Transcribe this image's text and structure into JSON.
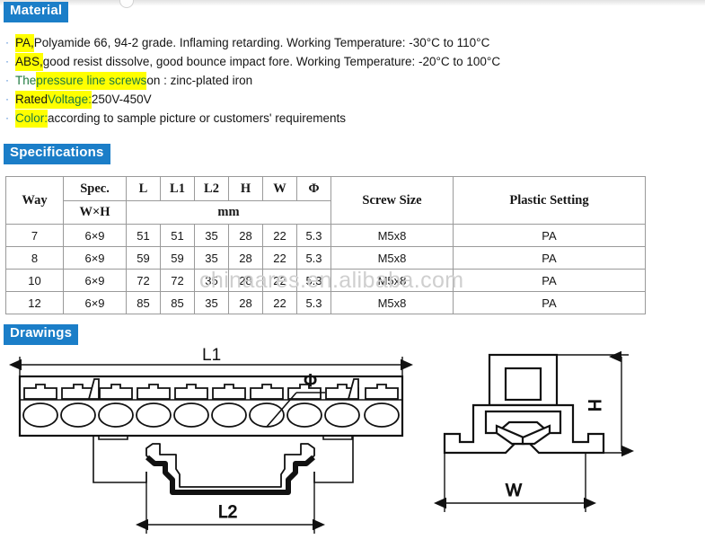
{
  "sections": {
    "material_title": "Material",
    "specifications_title": "Specifications",
    "drawings_title": "Drawings"
  },
  "material": {
    "bullet_glyph": "·",
    "items": [
      {
        "lead": "PA,",
        "lead_highlight": true,
        "lead_color": "black",
        "rest": " Polyamide 66, 94-2 grade. Inflaming retarding. Working Temperature:  -30°C to 110°C"
      },
      {
        "lead": "ABS,",
        "lead_highlight": true,
        "lead_color": "black",
        "rest": " good resist dissolve, good bounce impact fore. Working Temperature: -20°C to 100°C"
      },
      {
        "pre": "The ",
        "pre_color": "green",
        "mid": "pressure line screws",
        "mid_highlight": true,
        "mid_color": "green",
        "rest": " on :  zinc-plated iron"
      },
      {
        "lead": "Rated ",
        "lead_highlight": true,
        "lead_color": "black",
        "mid": "Voltage:",
        "mid_highlight": true,
        "mid_color": "green",
        "rest": "  250V-450V"
      },
      {
        "mid": "Color:",
        "mid_highlight": true,
        "mid_color": "green",
        "rest": " according to sample picture or customers' requirements"
      }
    ]
  },
  "spec_table": {
    "headers_row1": [
      "Way",
      "Spec.",
      "L",
      "L1",
      "L2",
      "H",
      "W",
      "Φ",
      "Screw Size",
      "Plastic Setting"
    ],
    "headers_row2_spec": "W×H",
    "headers_row2_unit": "mm",
    "rows": [
      {
        "way": "7",
        "spec": "6×9",
        "L": "51",
        "L1": "51",
        "L2": "35",
        "H": "28",
        "W": "22",
        "phi": "5.3",
        "screw": "M5x8",
        "plastic": "PA"
      },
      {
        "way": "8",
        "spec": "6×9",
        "L": "59",
        "L1": "59",
        "L2": "35",
        "H": "28",
        "W": "22",
        "phi": "5.3",
        "screw": "M5x8",
        "plastic": "PA"
      },
      {
        "way": "10",
        "spec": "6×9",
        "L": "72",
        "L1": "72",
        "L2": "35",
        "H": "28",
        "W": "22",
        "phi": "5.3",
        "screw": "M5x8",
        "plastic": "PA"
      },
      {
        "way": "12",
        "spec": "6×9",
        "L": "85",
        "L1": "85",
        "L2": "35",
        "H": "28",
        "W": "22",
        "phi": "5.3",
        "screw": "M5x8",
        "plastic": "PA"
      }
    ]
  },
  "watermark": {
    "text": "chinaares.en.alibaba.com"
  },
  "drawings": {
    "front_view": {
      "dim_overall": "L1",
      "dim_hole": "Φ",
      "dim_rail": "L2",
      "terminal_count": 10
    },
    "side_view": {
      "dim_height": "H",
      "dim_width": "W"
    }
  },
  "colors": {
    "badge_blue": "#1b7ec8",
    "highlight_yellow": "#ffff00",
    "green_text": "#1f7a3f",
    "bullet_blue": "#3f7fd0",
    "watermark_gray": "#cfcfcf",
    "table_border": "#9a9a9a"
  }
}
